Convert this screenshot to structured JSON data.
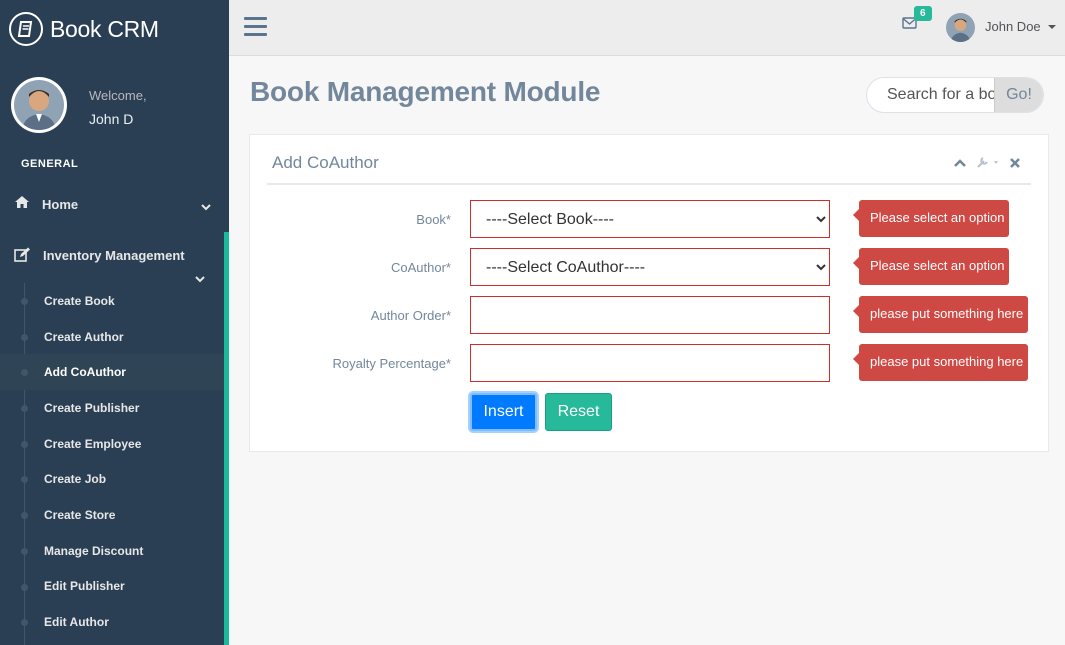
{
  "app": {
    "name": "Book CRM"
  },
  "sidebar": {
    "welcome": "Welcome,",
    "username": "John D",
    "section_title": "GENERAL",
    "home_label": "Home",
    "inventory_label": "Inventory Management",
    "items": [
      {
        "label": "Create Book",
        "active": false
      },
      {
        "label": "Create Author",
        "active": false
      },
      {
        "label": "Add CoAuthor",
        "active": true
      },
      {
        "label": "Create Publisher",
        "active": false
      },
      {
        "label": "Create Employee",
        "active": false
      },
      {
        "label": "Create Job",
        "active": false
      },
      {
        "label": "Create Store",
        "active": false
      },
      {
        "label": "Manage Discount",
        "active": false
      },
      {
        "label": "Edit Publisher",
        "active": false
      },
      {
        "label": "Edit Author",
        "active": false
      }
    ]
  },
  "topnav": {
    "mail_count": "6",
    "user_name": "John Doe"
  },
  "page": {
    "title": "Book Management Module",
    "search_placeholder": "Search for a book...",
    "search_button": "Go!"
  },
  "panel": {
    "title": "Add CoAuthor",
    "fields": [
      {
        "label": "Book*",
        "type": "select",
        "value": "----Select Book----",
        "error": "Please select an option"
      },
      {
        "label": "CoAuthor*",
        "type": "select",
        "value": "----Select CoAuthor----",
        "error": "Please select an option"
      },
      {
        "label": "Author Order*",
        "type": "text",
        "value": "",
        "error": "please put something here"
      },
      {
        "label": "Royalty Percentage*",
        "type": "text",
        "value": "",
        "error": "please put something here"
      }
    ],
    "insert_label": "Insert",
    "reset_label": "Reset"
  },
  "colors": {
    "sidebar_bg": "#2a3f54",
    "accent": "#1abb9c",
    "error": "#ce4844",
    "primary": "#007bff",
    "success": "#26b99a"
  }
}
